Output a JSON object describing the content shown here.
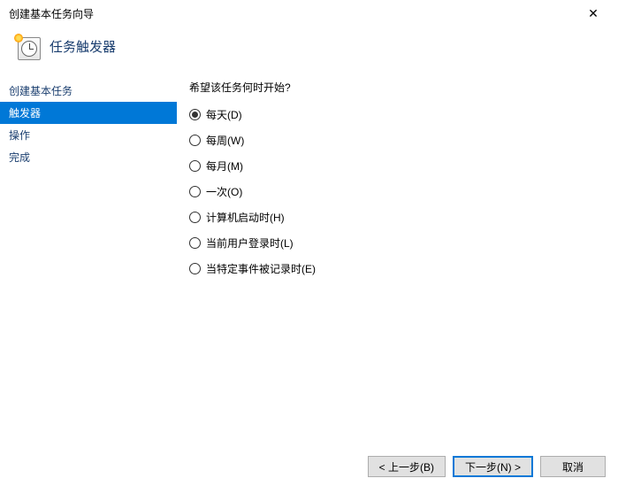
{
  "window": {
    "title": "创建基本任务向导"
  },
  "header": {
    "title": "任务触发器"
  },
  "sidebar": {
    "items": [
      {
        "label": "创建基本任务",
        "selected": false
      },
      {
        "label": "触发器",
        "selected": true
      },
      {
        "label": "操作",
        "selected": false
      },
      {
        "label": "完成",
        "selected": false
      }
    ]
  },
  "content": {
    "prompt": "希望该任务何时开始?",
    "options": [
      {
        "label": "每天(D)",
        "checked": true
      },
      {
        "label": "每周(W)",
        "checked": false
      },
      {
        "label": "每月(M)",
        "checked": false
      },
      {
        "label": "一次(O)",
        "checked": false
      },
      {
        "label": "计算机启动时(H)",
        "checked": false
      },
      {
        "label": "当前用户登录时(L)",
        "checked": false
      },
      {
        "label": "当特定事件被记录时(E)",
        "checked": false
      }
    ]
  },
  "footer": {
    "back": "< 上一步(B)",
    "next": "下一步(N) >",
    "cancel": "取消"
  }
}
